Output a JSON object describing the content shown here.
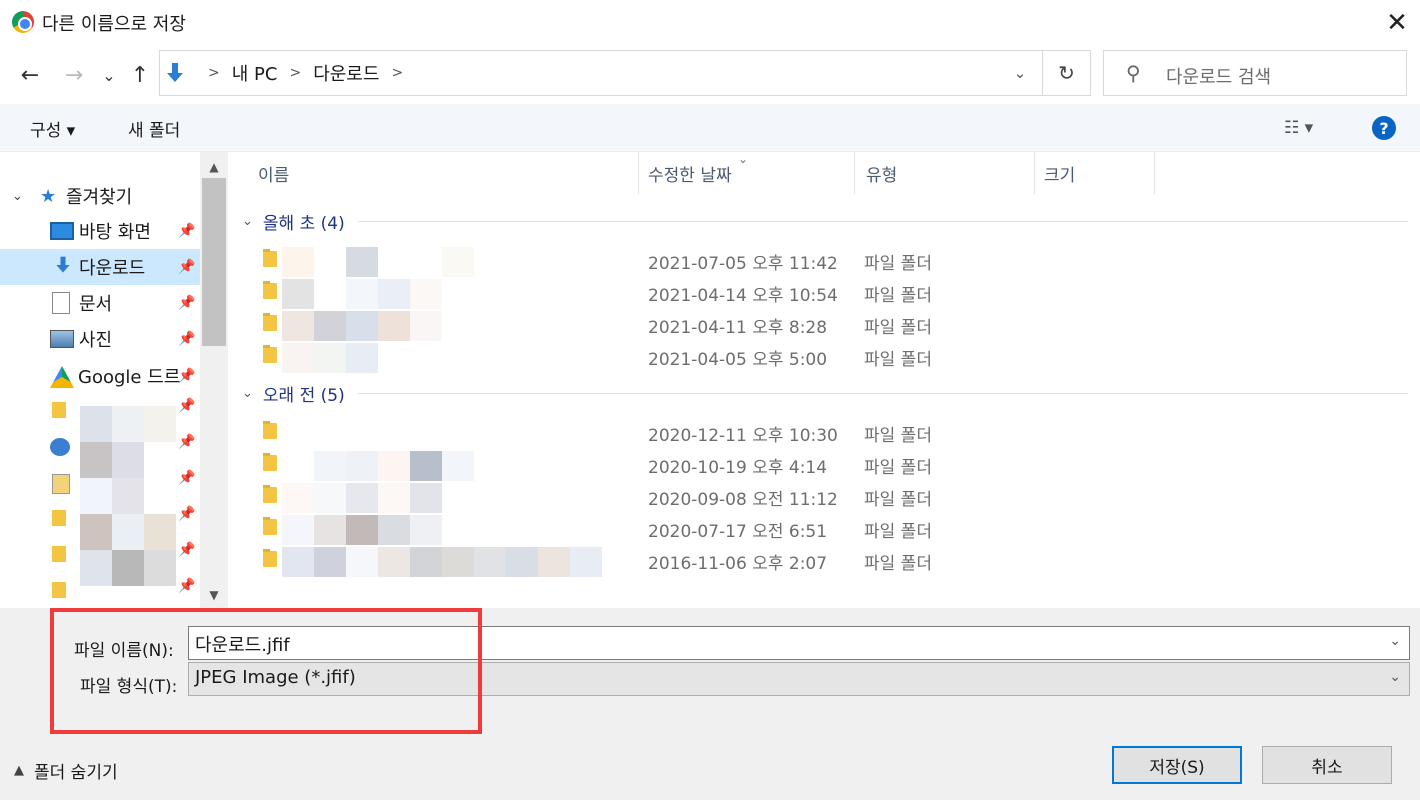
{
  "window": {
    "title": "다른 이름으로 저장",
    "close_glyph": "✕"
  },
  "nav": {
    "back_glyph": "←",
    "forward_glyph": "→",
    "recent_glyph": "⌄",
    "up_glyph": "↑",
    "breadcrumbs": [
      "내 PC",
      "다운로드"
    ],
    "dropdown_glyph": "⌄",
    "refresh_glyph": "↻",
    "search_placeholder": "다운로드 검색"
  },
  "toolbar": {
    "organize_label": "구성 ▾",
    "new_folder_label": "새 폴더",
    "view_glyph": "☷ ▾",
    "help_glyph": "?"
  },
  "sidebar": {
    "items": [
      {
        "label": "즐겨찾기",
        "icon": "star-icon"
      },
      {
        "label": "바탕 화면",
        "icon": "desktop-icon"
      },
      {
        "label": "다운로드",
        "icon": "download-icon"
      },
      {
        "label": "문서",
        "icon": "documents-icon"
      },
      {
        "label": "사진",
        "icon": "pictures-icon"
      },
      {
        "label": "Google 드르",
        "icon": "google-drive-icon"
      }
    ],
    "pin_glyph": "📌"
  },
  "columns": {
    "name": "이름",
    "modified": "수정한 날짜",
    "type": "유형",
    "size": "크기"
  },
  "groups": [
    {
      "label": "올해 초 (4)",
      "rows": [
        {
          "date": "2021-07-05 오후 11:42",
          "type": "파일 폴더"
        },
        {
          "date": "2021-04-14 오후 10:54",
          "type": "파일 폴더"
        },
        {
          "date": "2021-04-11 오후 8:28",
          "type": "파일 폴더"
        },
        {
          "date": "2021-04-05 오후 5:00",
          "type": "파일 폴더"
        }
      ]
    },
    {
      "label": "오래 전 (5)",
      "rows": [
        {
          "date": "2020-12-11 오후 10:30",
          "type": "파일 폴더"
        },
        {
          "date": "2020-10-19 오후 4:14",
          "type": "파일 폴더"
        },
        {
          "date": "2020-09-08 오전 11:12",
          "type": "파일 폴더"
        },
        {
          "date": "2020-07-17 오전 6:51",
          "type": "파일 폴더"
        },
        {
          "date": "2016-11-06 오후 2:07",
          "type": "파일 폴더"
        }
      ]
    }
  ],
  "form": {
    "filename_label": "파일 이름(N):",
    "filename_value": "다운로드.jfif",
    "filetype_label": "파일 형식(T):",
    "filetype_value": "JPEG Image (*.jfif)"
  },
  "footer": {
    "hide_folders_label": "폴더 숨기기",
    "save_label": "저장(S)",
    "cancel_label": "취소"
  },
  "colors": {
    "accent": "#0078d7",
    "highlight": "#ef3b3b",
    "selection": "#cce8ff"
  }
}
